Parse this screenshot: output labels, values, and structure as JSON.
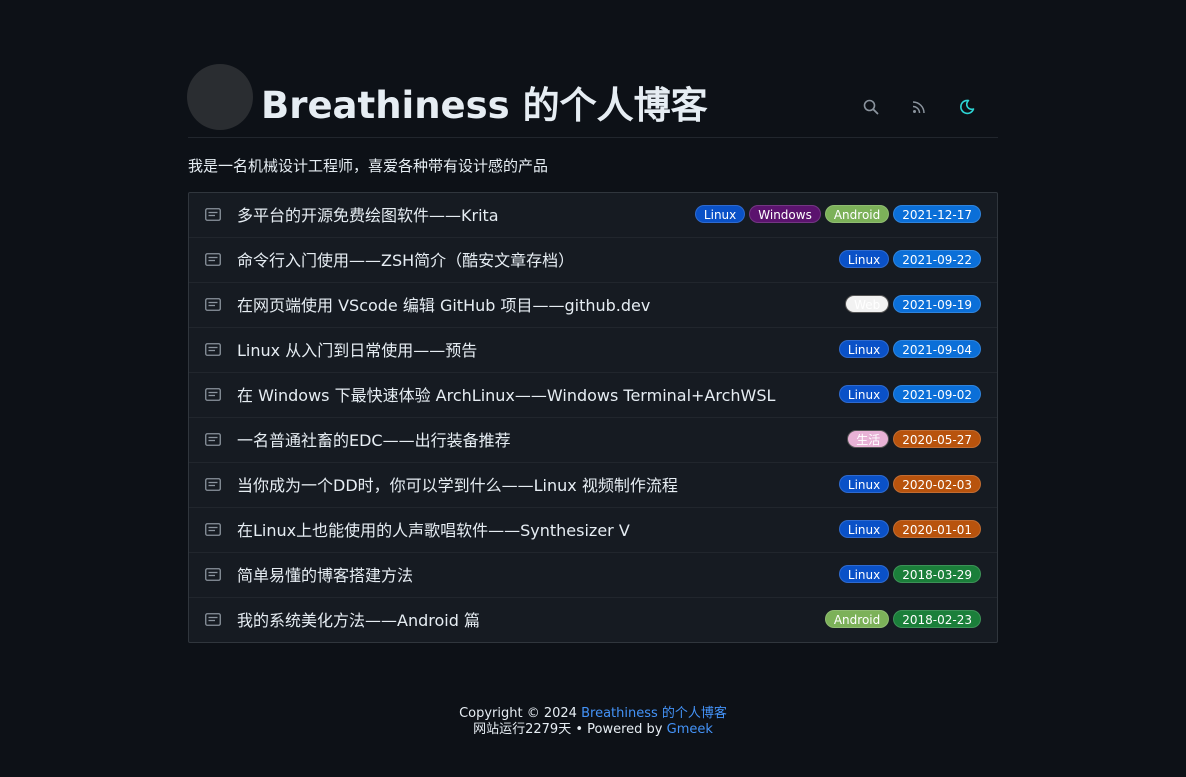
{
  "header": {
    "title": "Breathiness 的个人博客",
    "subtitle": "我是一名机械设计工程师，喜爱各种带有设计感的产品",
    "buttons": [
      {
        "name": "search-button",
        "icon": "search-icon"
      },
      {
        "name": "rss-button",
        "icon": "rss-icon"
      },
      {
        "name": "theme-toggle-button",
        "icon": "moon-icon"
      }
    ]
  },
  "colors": {
    "background": "#0d1117",
    "list_bg": "#161b22",
    "label_linux": "#0052cc",
    "label_windows": "#5319e7",
    "label_android": "#7bb661",
    "label_web": "#ededed",
    "label_life": "#e4a9d8",
    "date_blue": "#1d76db",
    "date_orange": "#c15a0d",
    "date_green": "#1a7f37",
    "link": "#4493f8",
    "moon": "#2dd4d4"
  },
  "posts": [
    {
      "title": "多平台的开源免费绘图软件——Krita",
      "labels": [
        {
          "text": "Linux",
          "color": "#0a51c7",
          "fg": "#ffffff"
        },
        {
          "text": "Windows",
          "color": "#5b136e",
          "fg": "#ffffff"
        },
        {
          "text": "Android",
          "color": "#7cb159",
          "fg": "#ffffff"
        }
      ],
      "date": "2021-12-17",
      "date_color": "#0b6fd8"
    },
    {
      "title": "命令行入门使用——ZSH简介（酷安文章存档）",
      "labels": [
        {
          "text": "Linux",
          "color": "#0a51c7",
          "fg": "#ffffff"
        }
      ],
      "date": "2021-09-22",
      "date_color": "#0b6fd8"
    },
    {
      "title": "在网页端使用 VScode 编辑 GitHub 项目——github.dev",
      "labels": [
        {
          "text": "Web",
          "color": "#f2f2f2",
          "fg": "#ffffff"
        }
      ],
      "date": "2021-09-19",
      "date_color": "#0b6fd8"
    },
    {
      "title": "Linux 从入门到日常使用——预告",
      "labels": [
        {
          "text": "Linux",
          "color": "#0a51c7",
          "fg": "#ffffff"
        }
      ],
      "date": "2021-09-04",
      "date_color": "#0b6fd8"
    },
    {
      "title": "在 Windows 下最快速体验 ArchLinux——Windows Terminal+ArchWSL",
      "labels": [
        {
          "text": "Linux",
          "color": "#0a51c7",
          "fg": "#ffffff"
        }
      ],
      "date": "2021-09-02",
      "date_color": "#0b6fd8"
    },
    {
      "title": "一名普通社畜的EDC——出行装备推荐",
      "labels": [
        {
          "text": "生活",
          "color": "#e8b2d6",
          "fg": "#ffffff"
        }
      ],
      "date": "2020-05-27",
      "date_color": "#b8530d"
    },
    {
      "title": "当你成为一个DD时，你可以学到什么——Linux 视频制作流程",
      "labels": [
        {
          "text": "Linux",
          "color": "#0a51c7",
          "fg": "#ffffff"
        }
      ],
      "date": "2020-02-03",
      "date_color": "#b8530d"
    },
    {
      "title": "在Linux上也能使用的人声歌唱软件——Synthesizer V",
      "labels": [
        {
          "text": "Linux",
          "color": "#0a51c7",
          "fg": "#ffffff"
        }
      ],
      "date": "2020-01-01",
      "date_color": "#b8530d"
    },
    {
      "title": "简单易懂的博客搭建方法",
      "labels": [
        {
          "text": "Linux",
          "color": "#0a51c7",
          "fg": "#ffffff"
        }
      ],
      "date": "2018-03-29",
      "date_color": "#1b7f3a"
    },
    {
      "title": "我的系统美化方法——Android 篇",
      "labels": [
        {
          "text": "Android",
          "color": "#7cb159",
          "fg": "#ffffff"
        }
      ],
      "date": "2018-02-23",
      "date_color": "#1b7f3a"
    }
  ],
  "footer": {
    "copyright_prefix": "Copyright © 2024 ",
    "copyright_link": "Breathiness 的个人博客",
    "uptime": "网站运行2279天",
    "separator": " • Powered by ",
    "powered_link": "Gmeek"
  }
}
